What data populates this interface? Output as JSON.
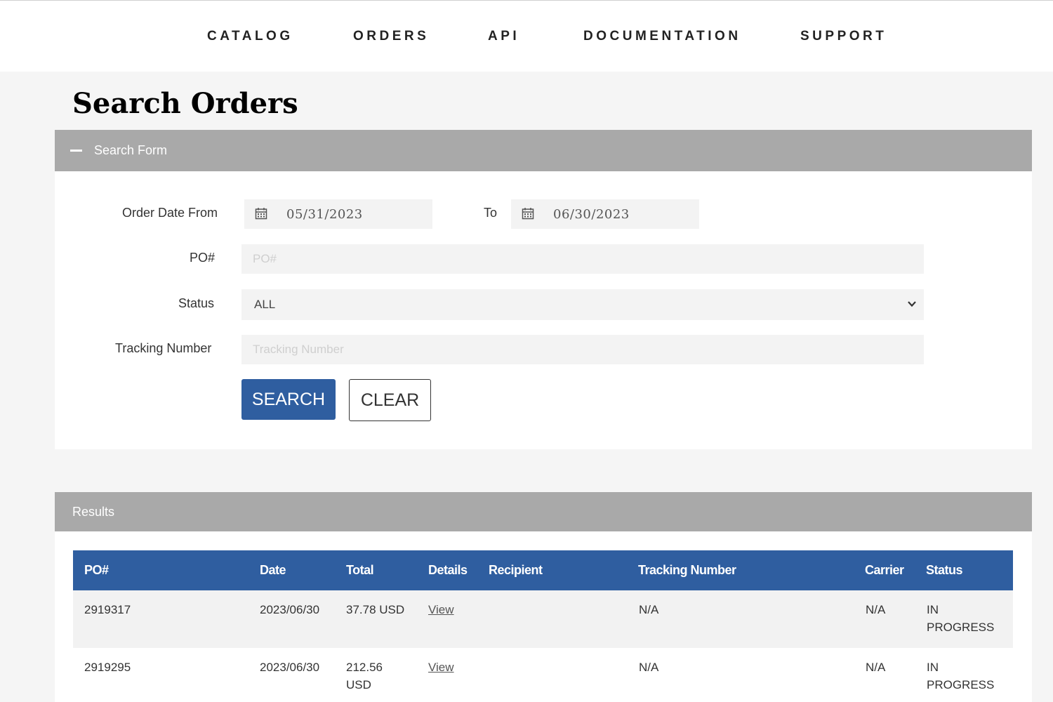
{
  "nav": {
    "items": [
      "CATALOG",
      "ORDERS",
      "API",
      "DOCUMENTATION",
      "SUPPORT"
    ]
  },
  "page": {
    "title": "Search Orders"
  },
  "search_form": {
    "header": "Search Form",
    "order_date_from_label": "Order Date From",
    "date_from": "05/31/2023",
    "to_label": "To",
    "date_to": "06/30/2023",
    "po_label": "PO#",
    "po_placeholder": "PO#",
    "status_label": "Status",
    "status_selected": "ALL",
    "tracking_label": "Tracking Number",
    "tracking_placeholder": "Tracking Number",
    "search_button": "SEARCH",
    "clear_button": "CLEAR"
  },
  "results": {
    "header": "Results",
    "columns": [
      "PO#",
      "Date",
      "Total",
      "Details",
      "Recipient",
      "Tracking Number",
      "Carrier",
      "Status"
    ],
    "rows": [
      {
        "po": "2919317",
        "date": "2023/06/30",
        "total": "37.78 USD",
        "details": "View",
        "recipient": "",
        "tracking": "N/A",
        "carrier": "N/A",
        "status": "IN PROGRESS"
      },
      {
        "po": "2919295",
        "date": "2023/06/30",
        "total": "212.56 USD",
        "details": "View",
        "recipient": "",
        "tracking": "N/A",
        "carrier": "N/A",
        "status": "IN PROGRESS"
      }
    ]
  },
  "colors": {
    "accent": "#2f5ea0",
    "panel_header": "#a9a9a9",
    "background": "#f5f5f5"
  }
}
